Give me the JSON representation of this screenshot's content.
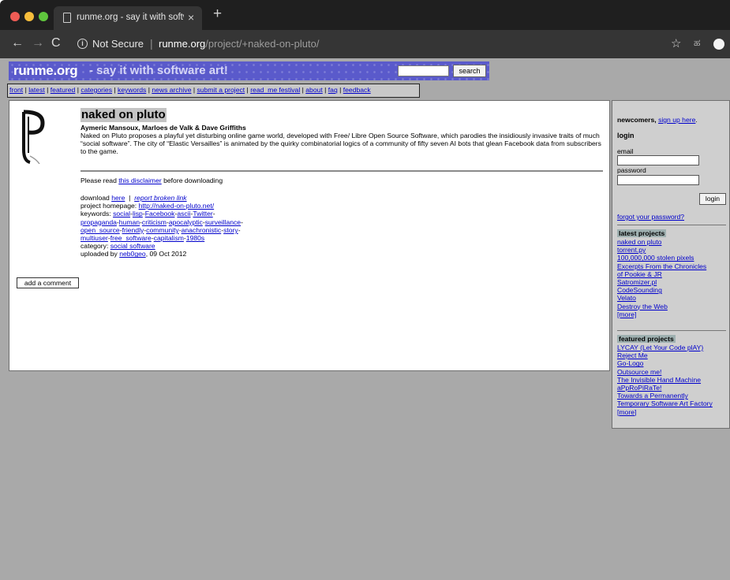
{
  "browser": {
    "tab_title": "runme.org - say it with software",
    "tab_close": "×",
    "new_tab": "+",
    "back": "←",
    "forward": "→",
    "reload": "C",
    "security_label": "Not Secure",
    "url_separator": "|",
    "url_host": "runme.org",
    "url_path": "/project/+naked-on-pluto/",
    "star": "☆",
    "extension": "ಹ"
  },
  "banner": {
    "site_name": "runme.org",
    "tagline": "- say it with software art!",
    "search_button": "search",
    "search_value": ""
  },
  "nav": {
    "items": [
      "front",
      "latest",
      "featured",
      "categories",
      "keywords",
      "news archive",
      "submit a project",
      "read_me festival",
      "about",
      "faq",
      "feedback"
    ],
    "separator": " | "
  },
  "project": {
    "title": "naked on pluto",
    "authors": "Aymeric Mansoux, Marloes de Valk & Dave Griffiths",
    "description": "Naked on Pluto proposes a playful yet disturbing online game world, developed with Free/ Libre Open Source Software, which parodies the insidiously invasive traits of much “social software”. The city of “Elastic Versailles” is animated by the quirky combinatorial logics of a community of fifty seven AI bots that glean Facebook data from subscribers to the game.",
    "read_prefix": "Please read ",
    "disclaimer_link": "this disclaimer",
    "read_suffix": " before downloading",
    "download_prefix": "download ",
    "download_link": "here",
    "download_sep": "  |  ",
    "report_link": "report broken link",
    "homepage_prefix": "project homepage: ",
    "homepage_link": "http://naked-on-pluto.net/",
    "keywords_prefix": "keywords: ",
    "keywords": [
      "social",
      "lisp",
      "Facebook",
      "ascii",
      "Twitter",
      "propaganda",
      "human",
      "criticism",
      "apocalyptic",
      "surveillance",
      "open_source",
      "friendly",
      "community",
      "anachronistic",
      "story",
      "multiuser",
      "free_software",
      "capitalism",
      "1980s"
    ],
    "category_prefix": "category: ",
    "category_link": "social software",
    "uploaded_prefix": "uploaded by ",
    "uploader_link": "neb0geo",
    "uploaded_date": ", 09 Oct 2012",
    "comment_button": "add a comment"
  },
  "sidebar": {
    "newcomers_label": "newcomers, ",
    "signup_link": "sign up here",
    "signup_suffix": ".",
    "login_heading": "login",
    "email_label": "email",
    "password_label": "password",
    "login_button": "login",
    "forgot_link": "forgot your password?",
    "latest_heading": "latest projects",
    "latest": [
      "naked on pluto",
      "torrent.py",
      "100,000,000 stolen pixels",
      "Excerpts From the Chronicles",
      "of Pookie & JR",
      "Satromizer.pl",
      "CodeSounding",
      "Velato",
      "Destroy the Web",
      "[more]"
    ],
    "featured_heading": "featured projects",
    "featured": [
      "LYCAY (Let Your Code plAY)",
      "Reject Me",
      "Go-Logo",
      "Outsource me!",
      "The Invisible Hand Machine",
      "aPpRoPiRaTe!",
      "Towards a Permanently",
      "Temporary Software Art Factory",
      "[more]"
    ]
  }
}
